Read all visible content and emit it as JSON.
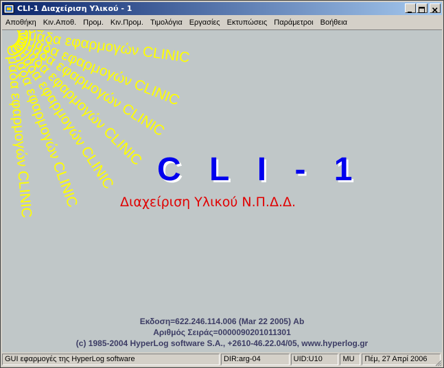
{
  "window": {
    "title": "CLI-1 Διαχείριση Υλικού - 1"
  },
  "menu": {
    "items": [
      "Αποθήκη",
      "Κιν.Αποθ.",
      "Προμ.",
      "Κιν.Προμ.",
      "Τιμολόγια",
      "Εργασίες",
      "Εκτυπώσεις",
      "Παράμετροι",
      "Βοήθεια"
    ]
  },
  "splash": {
    "arc_text": "Ομάδα εφαρμογών CLINIC",
    "title": "C L I - 1",
    "subtitle": "Διαχείριση Υλικού Ν.Π.Δ.Δ.",
    "version": "Εκδοση=622.246.114.006 (Mar 22 2005) Ab",
    "serial": "Αριθμός Σειράς=0000090201011301",
    "copyright": "(c) 1985-2004 HyperLog software S.A., +2610-46.22.04/05, www.hyperlog.gr"
  },
  "statusbar": {
    "app": "GUI εφαρμογές της HyperLog software",
    "dir": "DIR:arg-04",
    "uid": "UID:U10",
    "mode": "MU",
    "date": "Πέμ, 27 Απρί 2006"
  },
  "colors": {
    "title_blue": "#0000ee",
    "subtitle_red": "#e00000",
    "arc_yellow": "#ffff00",
    "client_bg": "#c0c7c8",
    "info_text": "#3c3c64"
  }
}
